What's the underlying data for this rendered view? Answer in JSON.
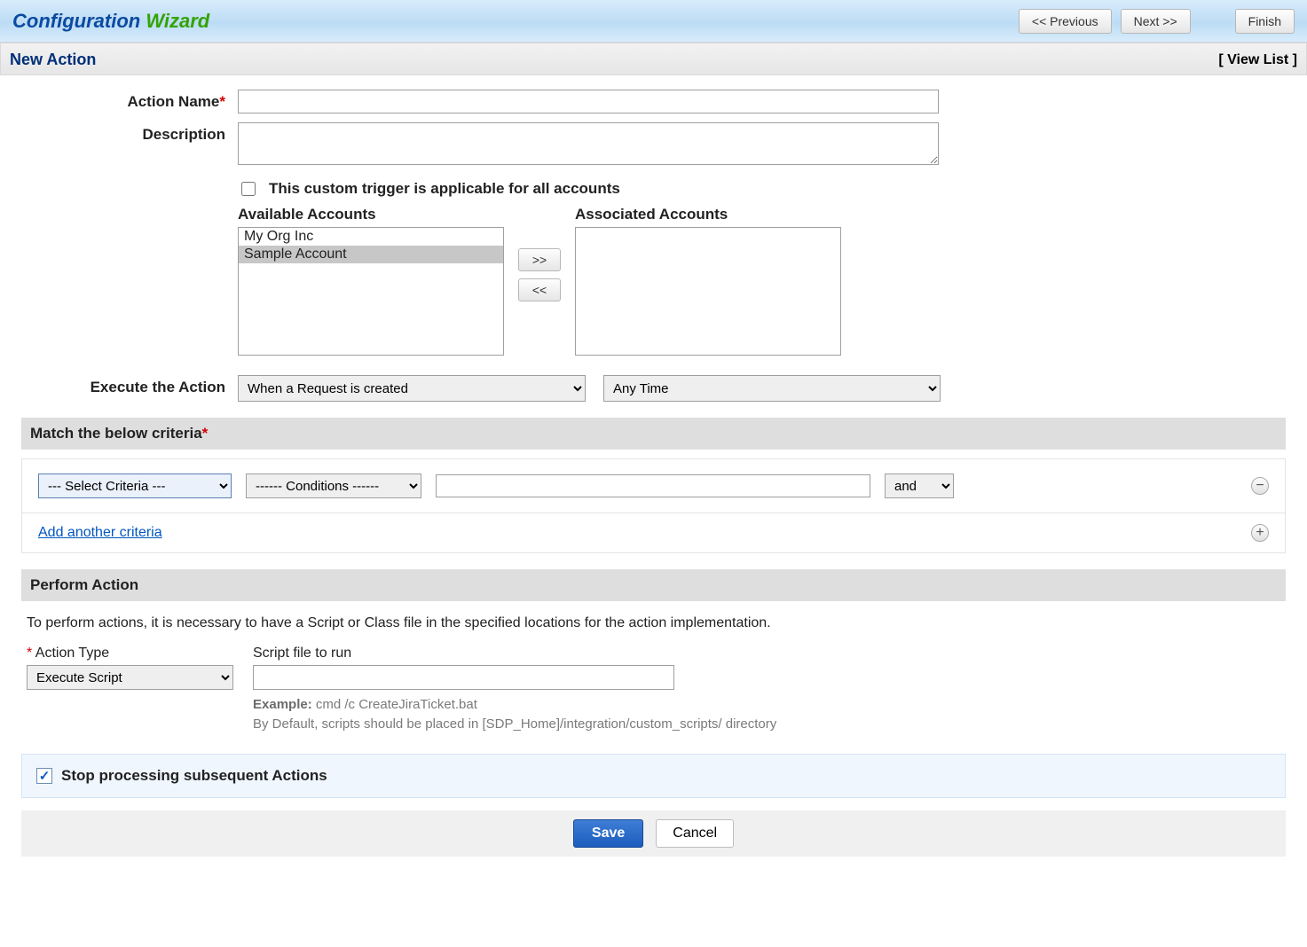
{
  "header": {
    "title_part1": "Configuration ",
    "title_part2": "Wizard",
    "prev_label": "<< Previous",
    "next_label": "Next >>",
    "finish_label": "Finish"
  },
  "subhead": {
    "title": "New Action",
    "view_list": "[  View List  ]"
  },
  "form": {
    "action_name_label": "Action Name",
    "action_name_value": "",
    "description_label": "Description",
    "description_value": "",
    "all_accounts_checkbox_label": "This custom trigger is applicable for all accounts",
    "all_accounts_checked": false,
    "available_accounts_label": "Available Accounts",
    "associated_accounts_label": "Associated Accounts",
    "available_accounts": [
      "My Org Inc",
      "Sample Account"
    ],
    "associated_accounts": [],
    "move_right_label": ">>",
    "move_left_label": "<<",
    "execute_label": "Execute the Action",
    "execute_when_value": "When a Request is created",
    "execute_time_value": "Any Time"
  },
  "criteria": {
    "section_title": "Match the below criteria",
    "select_criteria_value": "--- Select Criteria ---",
    "conditions_value": "------ Conditions ------",
    "value_input": "",
    "logic_value": "and",
    "add_another_label": "Add another criteria"
  },
  "perform": {
    "section_title": "Perform Action",
    "description": "To perform actions, it is necessary to have a Script or Class file in the specified locations for the action implementation.",
    "action_type_label": "Action Type",
    "action_type_value": "Execute Script",
    "script_file_label": "Script file to run",
    "script_file_value": "",
    "example_prefix": "Example: ",
    "example_cmd": "cmd /c CreateJiraTicket.bat",
    "example_note": "By Default, scripts should be placed in [SDP_Home]/integration/custom_scripts/ directory"
  },
  "stop": {
    "checked": true,
    "label": "Stop processing subsequent Actions"
  },
  "buttons": {
    "save": "Save",
    "cancel": "Cancel"
  }
}
